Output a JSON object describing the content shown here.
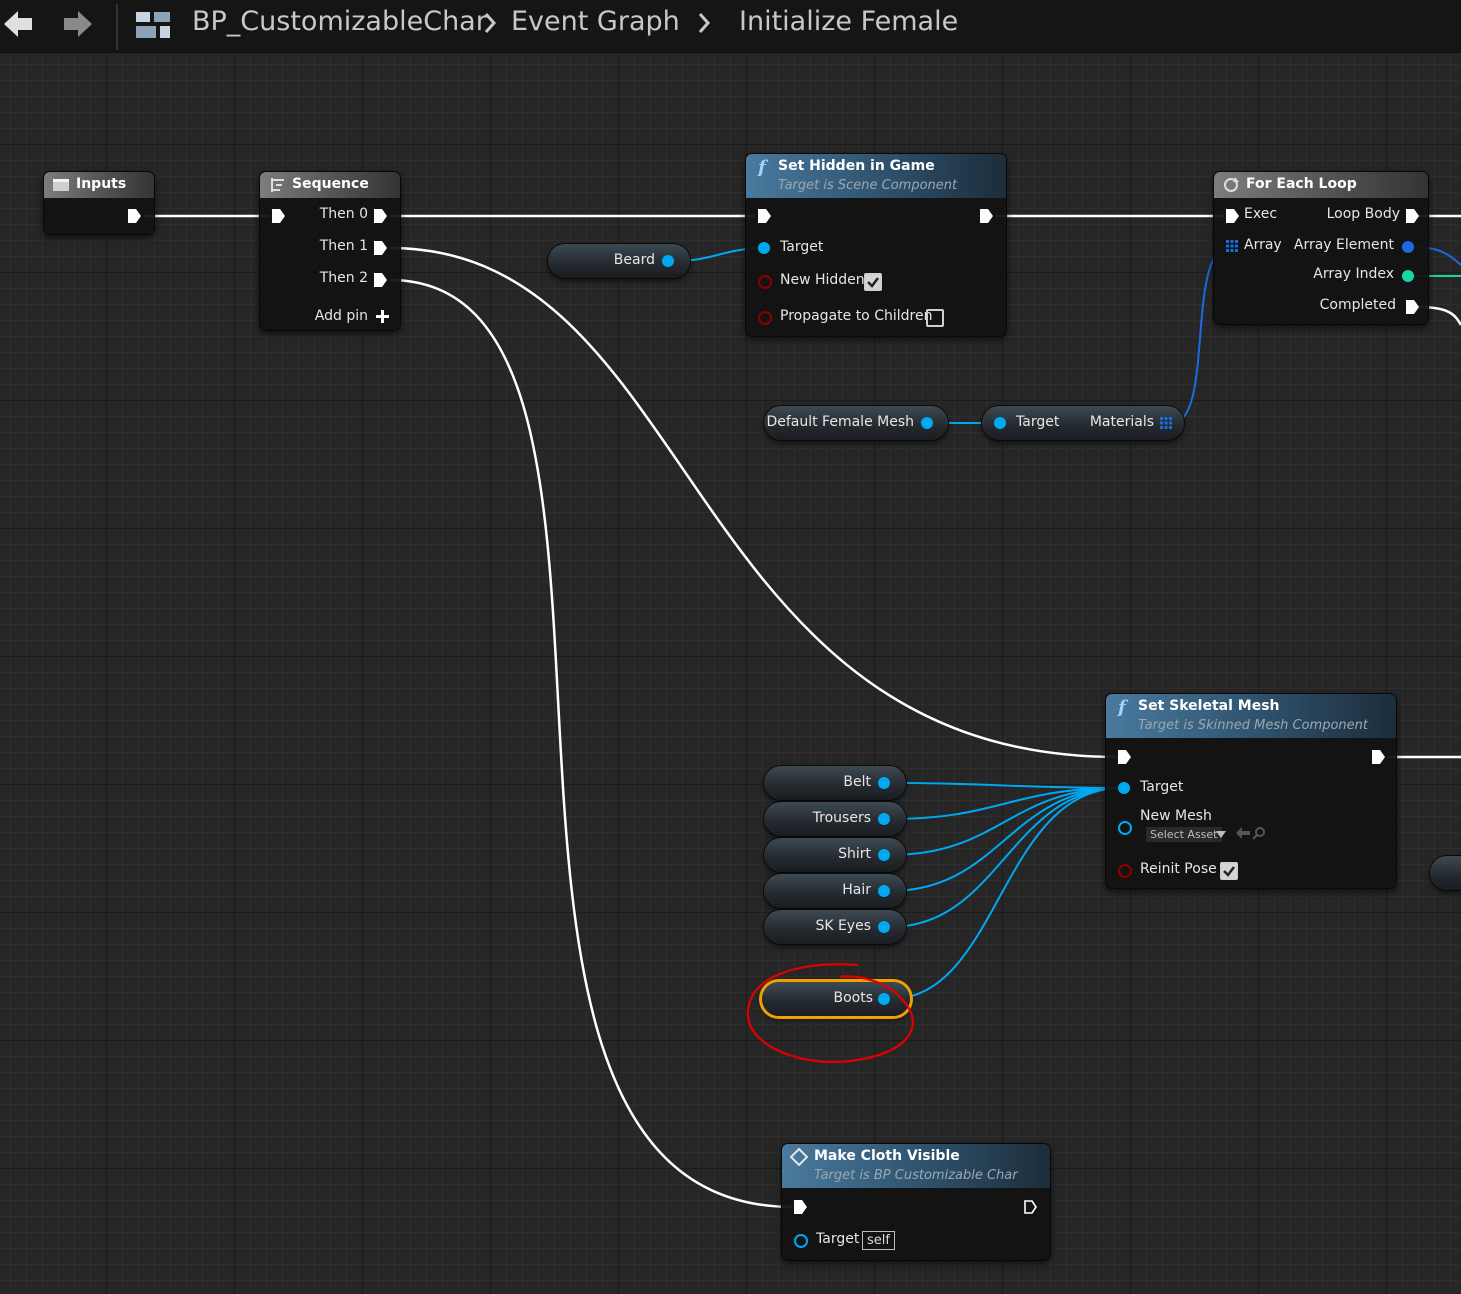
{
  "breadcrumb": {
    "blueprint": "BP_CustomizableChar",
    "graph": "Event Graph",
    "function": "Initialize Female"
  },
  "colors": {
    "exec_wire": "#ffffff",
    "object_pin": "#00a8f2",
    "bool_pin": "#8b0000",
    "int_pin": "#18d6a4",
    "function_header": "#305470",
    "selection": "#f0a000",
    "annotation": "#e00000"
  },
  "nodes": {
    "inputs": {
      "title": "Inputs",
      "icon": "entry-icon"
    },
    "sequence": {
      "title": "Sequence",
      "outputs": [
        "Then 0",
        "Then 1",
        "Then 2"
      ],
      "add_pin": "Add pin"
    },
    "set_hidden": {
      "title": "Set Hidden in Game",
      "subtitle": "Target is Scene Component",
      "target": "Target",
      "new_hidden": "New Hidden",
      "new_hidden_checked": true,
      "propagate": "Propagate to Children",
      "propagate_checked": false
    },
    "for_each": {
      "title": "For Each Loop",
      "exec": "Exec",
      "array": "Array",
      "loop_body": "Loop Body",
      "array_element": "Array Element",
      "array_index": "Array Index",
      "completed": "Completed"
    },
    "get_materials": {
      "target": "Target",
      "output": "Materials"
    },
    "set_skeletal": {
      "title": "Set Skeletal Mesh",
      "subtitle": "Target is Skinned Mesh Component",
      "target": "Target",
      "new_mesh": "New Mesh",
      "select_asset": "Select Asset",
      "reinit_pose": "Reinit Pose",
      "reinit_checked": true
    },
    "make_cloth": {
      "title": "Make Cloth Visible",
      "subtitle": "Target is BP Customizable Char",
      "target": "Target",
      "target_default": "self"
    }
  },
  "variables": {
    "beard": "Beard",
    "default_female_mesh": "Default Female Mesh",
    "belt": "Belt",
    "trousers": "Trousers",
    "shirt": "Shirt",
    "hair": "Hair",
    "sk_eyes": "SK Eyes",
    "boots": "Boots"
  },
  "selected_variable": "Boots"
}
